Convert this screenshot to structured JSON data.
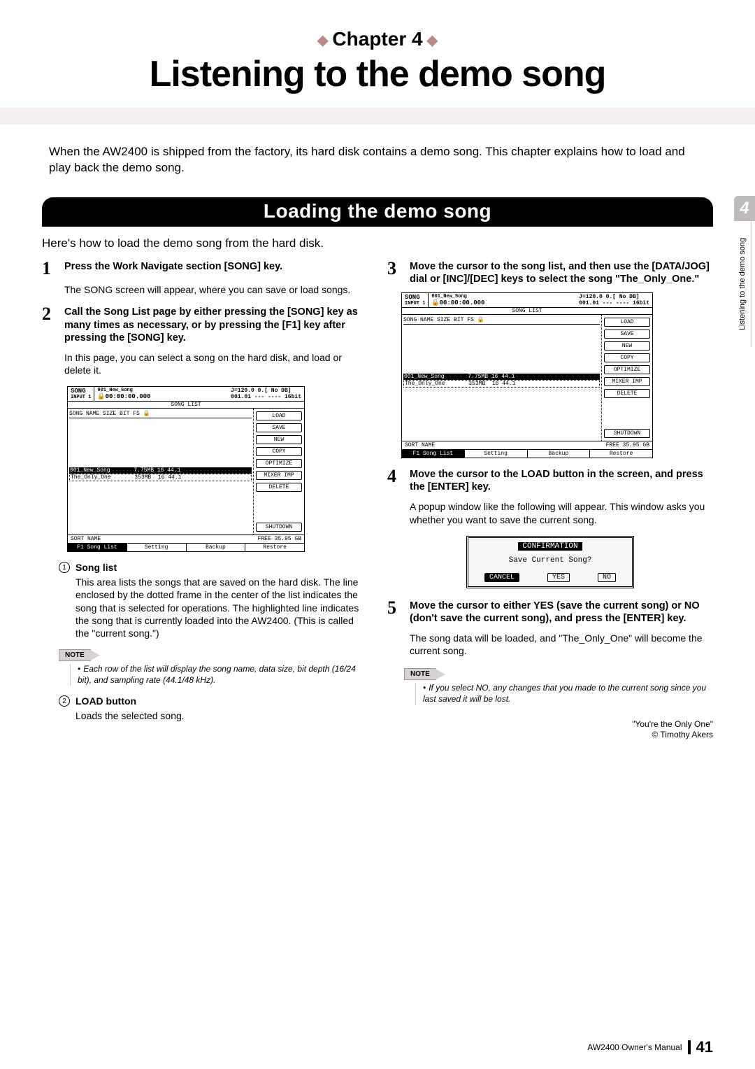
{
  "chapter_label": "Chapter 4",
  "main_title": "Listening to the demo song",
  "intro": "When the AW2400 is shipped from the factory, its hard disk contains a demo song. This chapter explains how to load and play back the demo song.",
  "section_heading": "Loading the demo song",
  "section_intro": "Here's how to load the demo song from the hard disk.",
  "left": {
    "step1_title": "Press the Work Navigate section [SONG] key.",
    "step1_body": "The SONG screen will appear, where you can save or load songs.",
    "step2_title": "Call the Song List page by either pressing the [SONG] key as many times as necessary, or by pressing the [F1] key after pressing the [SONG] key.",
    "step2_body": "In this page, you can select a song on the hard disk, and load or delete it.",
    "c1_label": "Song list",
    "c1_text": "This area lists the songs that are saved on the hard disk. The line enclosed by the dotted frame in the center of the list indicates the song that is selected for operations. The highlighted line indicates the song that is currently loaded into the AW2400. (This is called the \"current song.\")",
    "note1": "Each row of the list will display the song name, data size, bit depth (16/24 bit), and sampling rate (44.1/48 kHz).",
    "c2_label": "LOAD button",
    "c2_text": "Loads the selected song."
  },
  "right": {
    "step3_title": "Move the cursor to the song list, and then use the [DATA/JOG] dial or [INC]/[DEC] keys to select the song \"The_Only_One.\"",
    "step4_title": "Move the cursor to the LOAD button in the screen, and press the [ENTER] key.",
    "step4_body": "A popup window like the following will appear. This window asks you whether you want to save the current song.",
    "step5_title": "Move the cursor to either YES (save the current song) or NO (don't save the current song), and press the [ENTER] key.",
    "step5_body": "The song data will be loaded, and \"The_Only_One\" will become the current song.",
    "note2": "If you select NO, any changes that you made to the current song since you last saved it will be lost.",
    "credit_line1": "\"You're the Only One\"",
    "credit_line2": "© Timothy Akers"
  },
  "lcd": {
    "title_l": "SONG",
    "title_sub": "INPUT 1",
    "title_mid_top": "001_New_Song",
    "title_mid_bot": "🔒00:00:00.000",
    "title_r_top": "J=120.0  0.[     No DB]",
    "title_r_bot": "001.01 --- ---- 16bit",
    "list_head": "SONG NAME          SIZE  BIT FS  🔒",
    "list_banner": "SONG LIST",
    "row1": "001_New_Song       7.75MB 16 44.1",
    "row2": "The_Only_One       353MB  16 44.1",
    "sortfree_l": "SORT NAME",
    "sortfree_r": "FREE   35.95 GB",
    "btns": [
      "LOAD",
      "SAVE",
      "NEW",
      "COPY",
      "OPTIMIZE",
      "MIXER IMP",
      "DELETE",
      "SHUTDOWN"
    ],
    "tabs": [
      "Song List",
      "Setting",
      "Backup",
      "Restore"
    ],
    "tab_prefix": "F1"
  },
  "popup": {
    "title": "CONFIRMATION",
    "msg": "Save Current Song?",
    "btns": [
      "CANCEL",
      "YES",
      "NO"
    ]
  },
  "side": {
    "num": "4",
    "text": "Listening to the demo song"
  },
  "footer": {
    "manual": "AW2400  Owner's Manual",
    "page": "41"
  },
  "labels": {
    "note": "NOTE"
  }
}
